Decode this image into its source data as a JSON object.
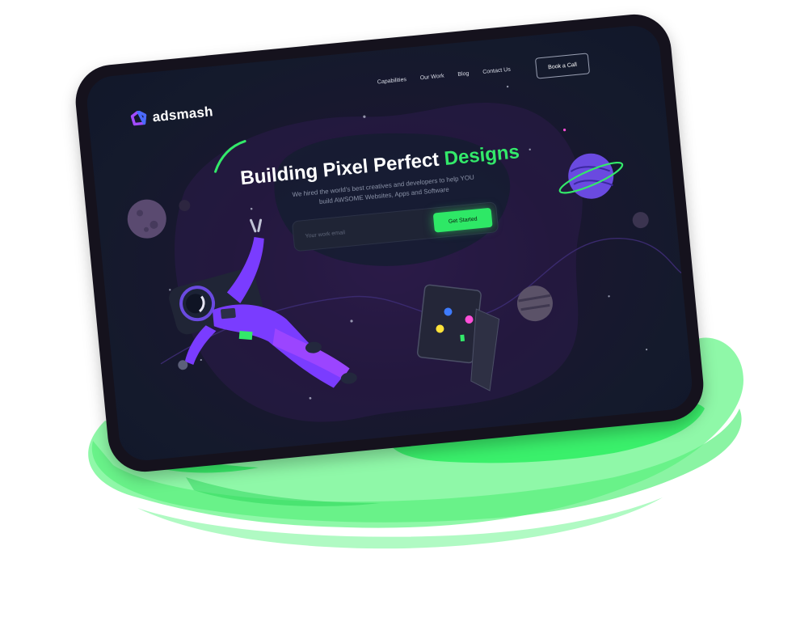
{
  "brand": {
    "name": "adsmash"
  },
  "nav": {
    "items": [
      {
        "label": "Capabilities"
      },
      {
        "label": "Our Work"
      },
      {
        "label": "Blog"
      },
      {
        "label": "Contact Us"
      }
    ],
    "cta_label": "Book a Call"
  },
  "hero": {
    "title_main": "Building Pixel Perfect ",
    "title_accent": "Designs",
    "subtitle": "We hired the world's best creatives and developers to help YOU build AWSOME Websites, Apps and Software",
    "email_placeholder": "Your work email",
    "button_label": "Get Started"
  },
  "colors": {
    "accent_green": "#33e96a",
    "tablet_frame": "#15121d",
    "background": "#ffffff",
    "astronaut_purple": "#7a3cff"
  },
  "icons": [
    "adsmash-logo-icon",
    "astronaut-illustration",
    "laptop-illustration",
    "planet-icon"
  ]
}
